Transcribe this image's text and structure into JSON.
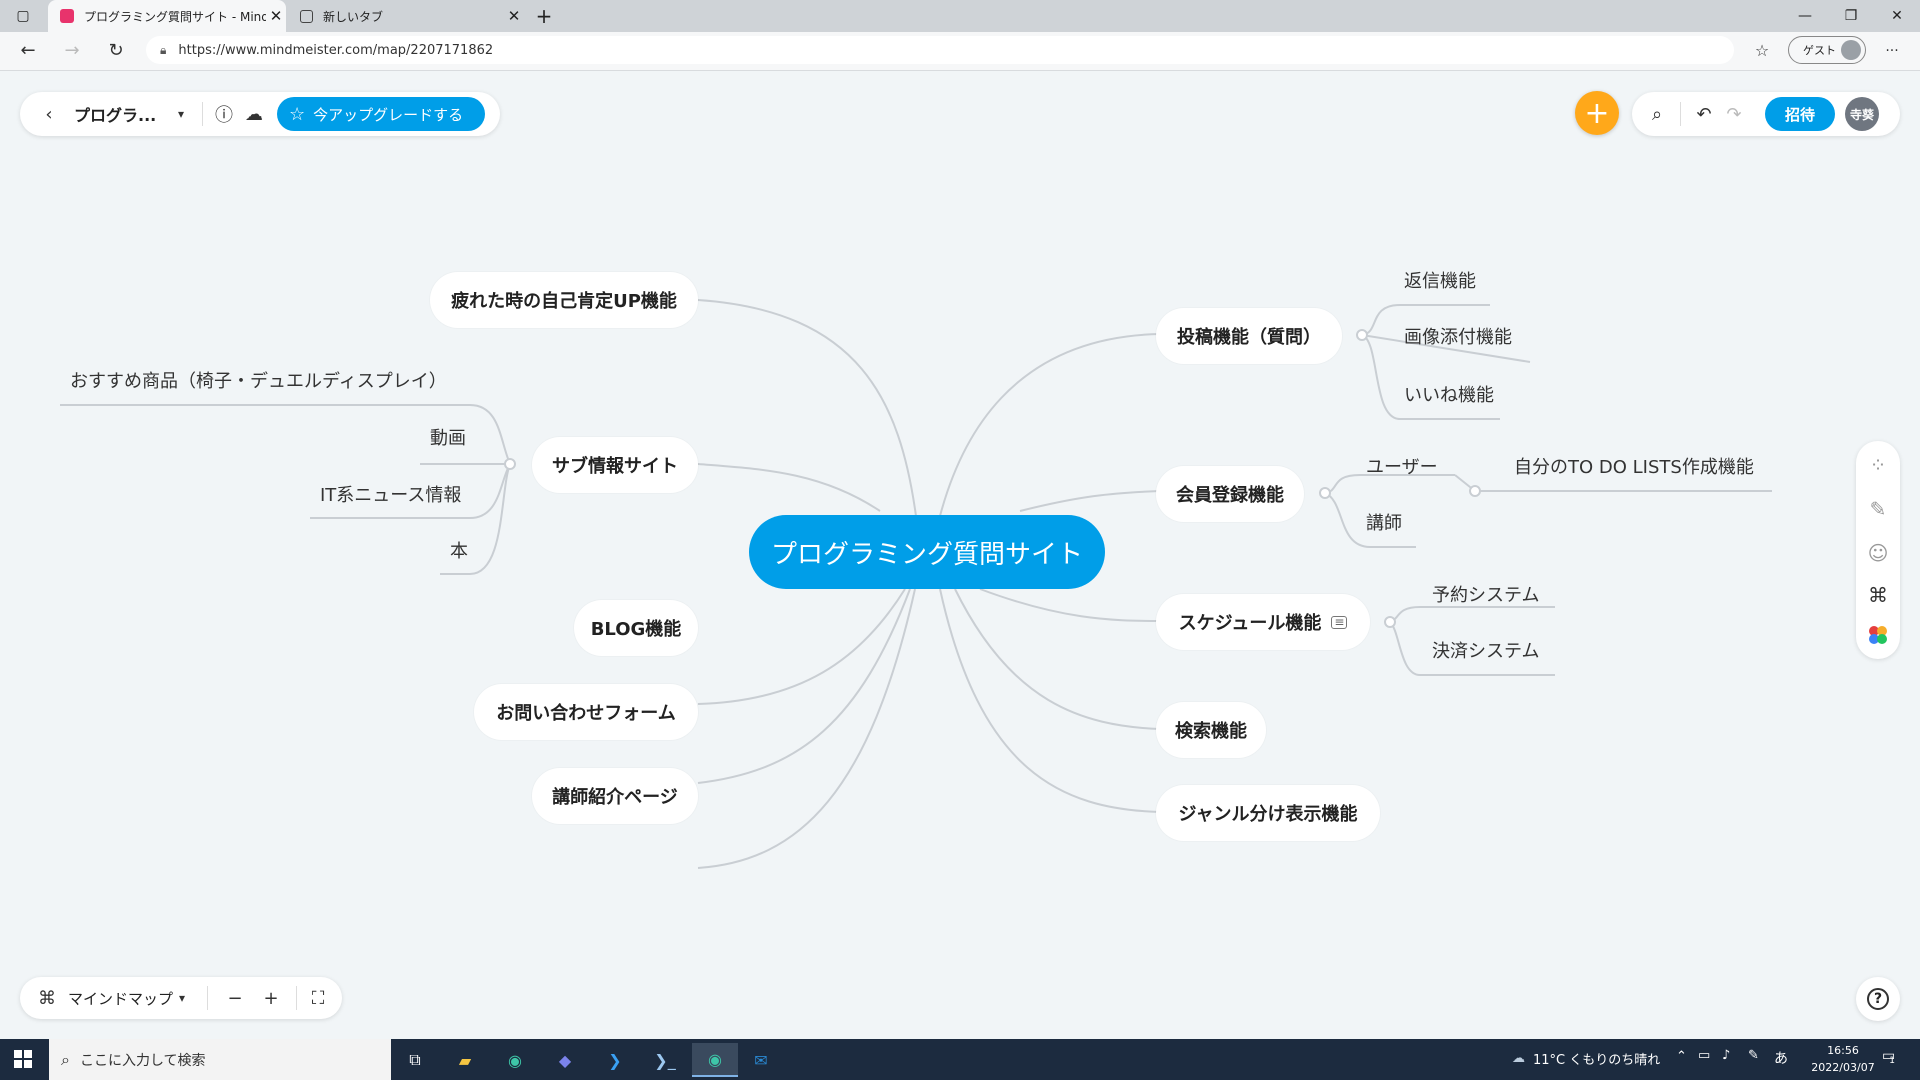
{
  "browser": {
    "tabs": [
      {
        "title": "プログラミング質問サイト - MindMei"
      },
      {
        "title": "新しいタブ"
      }
    ],
    "new_tab": "+",
    "url": "https://www.mindmeister.com/map/2207171862",
    "profile_label": "ゲスト",
    "more": "···"
  },
  "toolbar": {
    "map_title": "プログラ...",
    "upgrade_label": "今アップグレードする",
    "invite_label": "招待",
    "user_avatar": "寺葵"
  },
  "mindmap": {
    "root": "プログラミング質問サイト",
    "left": {
      "n1": "疲れた時の自己肯定UP機能",
      "n2": "サブ情報サイト",
      "n2_children": [
        "おすすめ商品（椅子・デュエルディスプレイ）",
        "動画",
        "IT系ニュース情報",
        "本"
      ],
      "n3": "BLOG機能",
      "n4": "お問い合わせフォーム",
      "n5": "講師紹介ページ"
    },
    "right": {
      "n1": "投稿機能（質問）",
      "n1_children": [
        "返信機能",
        "画像添付機能",
        "いいね機能"
      ],
      "n2": "会員登録機能",
      "n2_children": [
        "ユーザー",
        "講師"
      ],
      "n2_grandchild": "自分のTO DO LISTS作成機能",
      "n3": "スケジュール機能",
      "n3_children": [
        "予約システム",
        "決済システム"
      ],
      "n4": "検索機能",
      "n5": "ジャンル分け表示機能"
    }
  },
  "bottom": {
    "view_label": "マインドマップ",
    "zoom_out": "−",
    "zoom_in": "+",
    "help": "?"
  },
  "taskbar": {
    "search_placeholder": "ここに入力して検索",
    "weather": "11°C くもりのち晴れ",
    "ime": "あ",
    "time": "16:56",
    "date": "2022/03/07",
    "notification_count": "1"
  },
  "colors": {
    "accent": "#009ee8",
    "add_button": "#ffa81a",
    "canvas": "#f1f5f7",
    "line": "#c9ced3"
  }
}
